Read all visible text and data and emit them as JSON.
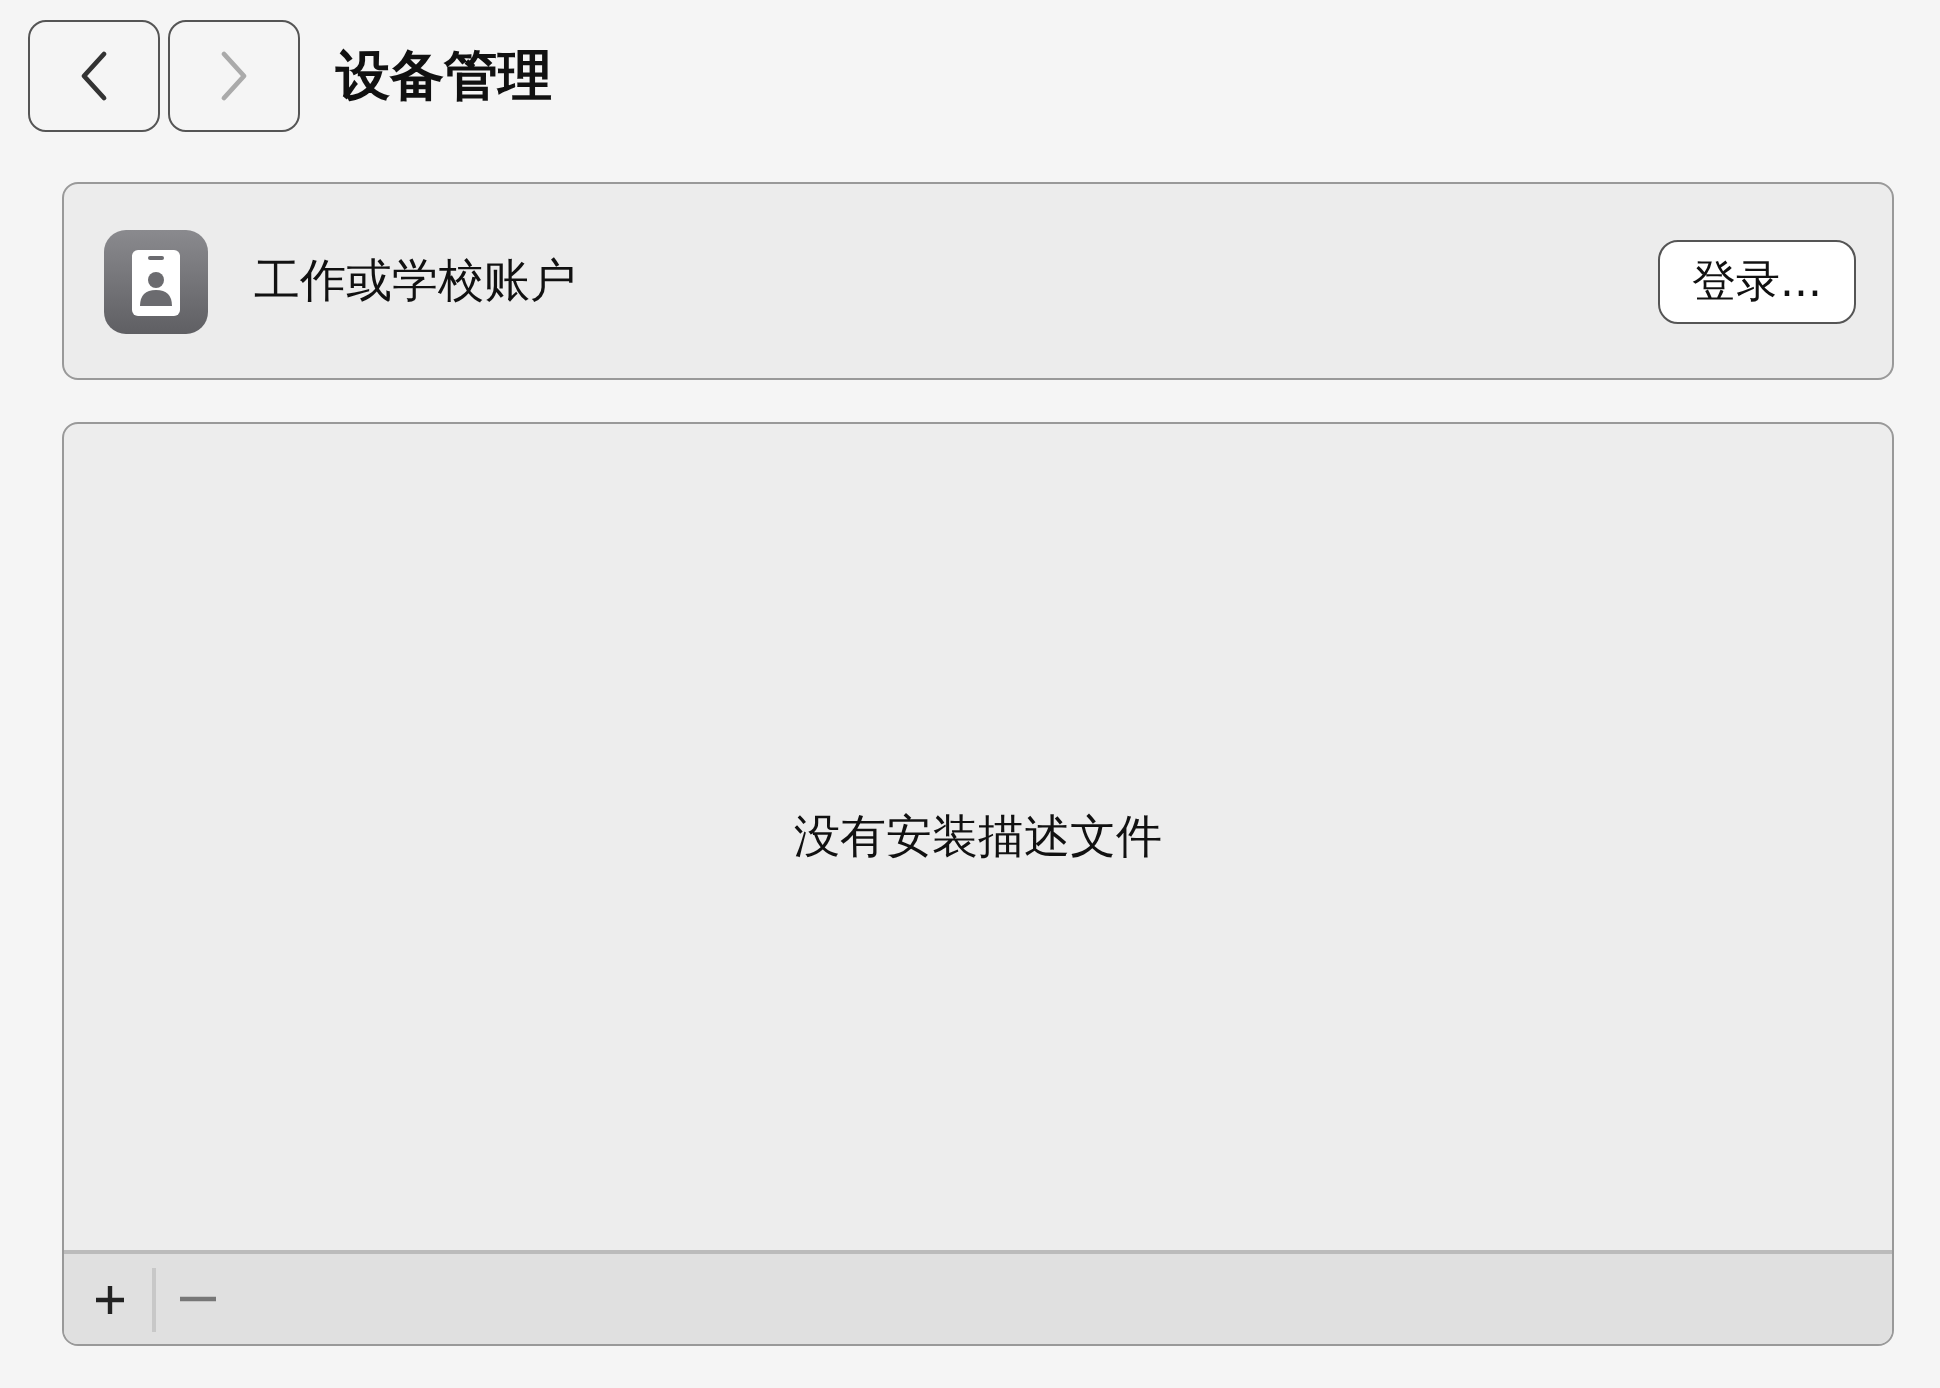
{
  "toolbar": {
    "nav_buttons": [
      {
        "kind": "back",
        "disabled": false
      },
      {
        "kind": "forward",
        "disabled": true
      }
    ],
    "title": "设备管理"
  },
  "account": {
    "label": "工作或学校账户",
    "button": "登录..."
  },
  "profiles": {
    "empty_message": "没有安装描述文件",
    "actions": [
      {
        "kind": "add",
        "disabled": false
      },
      {
        "kind": "remove",
        "disabled": true
      }
    ]
  }
}
